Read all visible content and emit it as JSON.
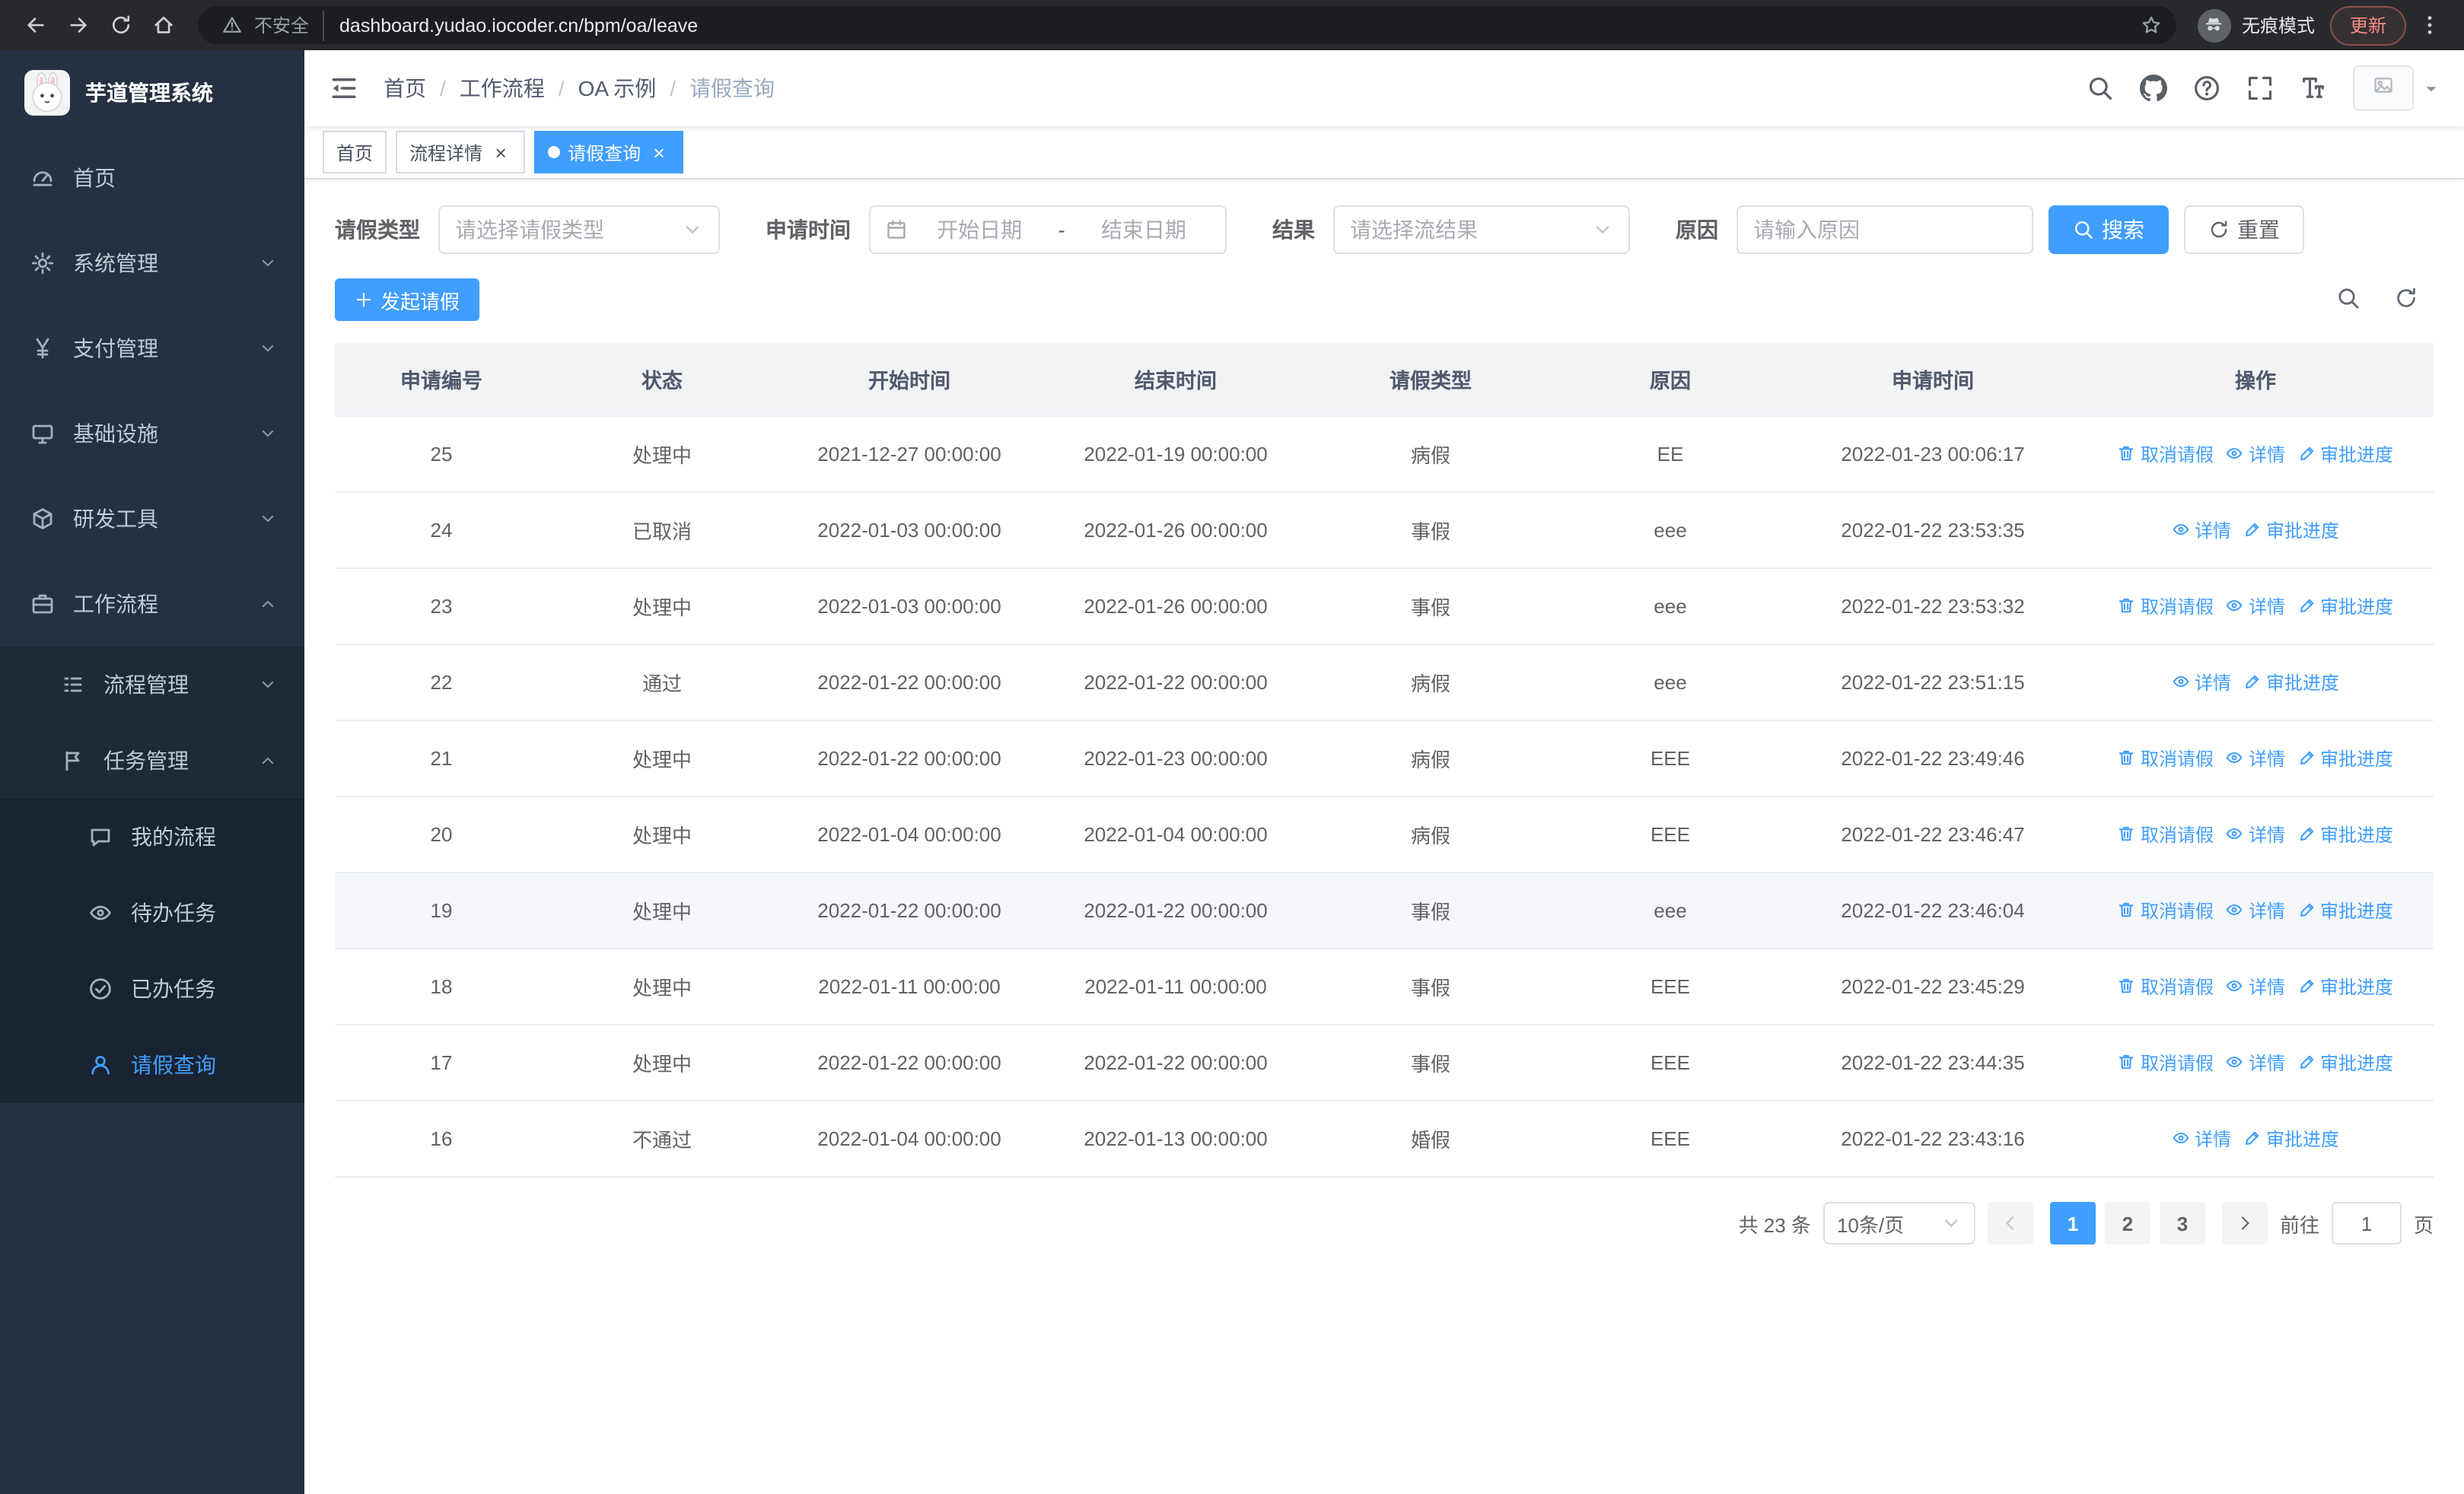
{
  "browser": {
    "security_label": "不安全",
    "url": "dashboard.yudao.iocoder.cn/bpm/oa/leave",
    "incognito_label": "无痕模式",
    "update_label": "更新"
  },
  "sidebar": {
    "app_title": "芋道管理系统",
    "items": [
      {
        "key": "home",
        "label": "首页",
        "icon": "dashboard",
        "level": 0,
        "arrow": null,
        "active": false
      },
      {
        "key": "system-management",
        "label": "系统管理",
        "icon": "gear",
        "level": 0,
        "arrow": "down",
        "active": false
      },
      {
        "key": "payment-management",
        "label": "支付管理",
        "icon": "yen",
        "level": 0,
        "arrow": "down",
        "active": false
      },
      {
        "key": "infrastructure",
        "label": "基础设施",
        "icon": "monitor",
        "level": 0,
        "arrow": "down",
        "active": false
      },
      {
        "key": "dev-tools",
        "label": "研发工具",
        "icon": "cube",
        "level": 0,
        "arrow": "down",
        "active": false
      },
      {
        "key": "workflow",
        "label": "工作流程",
        "icon": "briefcase",
        "level": 0,
        "arrow": "up",
        "active": false
      },
      {
        "key": "process-management",
        "label": "流程管理",
        "icon": "list",
        "level": 1,
        "arrow": "down",
        "active": false
      },
      {
        "key": "task-management",
        "label": "任务管理",
        "icon": "flag",
        "level": 1,
        "arrow": "up",
        "active": false
      },
      {
        "key": "my-process",
        "label": "我的流程",
        "icon": "chat",
        "level": 2,
        "arrow": null,
        "active": false
      },
      {
        "key": "todo-task",
        "label": "待办任务",
        "icon": "eye",
        "level": 2,
        "arrow": null,
        "active": false
      },
      {
        "key": "done-task",
        "label": "已办任务",
        "icon": "check-circle",
        "level": 2,
        "arrow": null,
        "active": false
      },
      {
        "key": "leave-query",
        "label": "请假查询",
        "icon": "user",
        "level": 2,
        "arrow": null,
        "active": true
      }
    ]
  },
  "header": {
    "breadcrumb": [
      "首页",
      "工作流程",
      "OA 示例",
      "请假查询"
    ]
  },
  "tabs": [
    {
      "key": "home",
      "label": "首页",
      "closable": false,
      "active": false
    },
    {
      "key": "process-detail",
      "label": "流程详情",
      "closable": true,
      "active": false
    },
    {
      "key": "leave-query",
      "label": "请假查询",
      "closable": true,
      "active": true
    }
  ],
  "filters": {
    "leave_type": {
      "label": "请假类型",
      "placeholder": "请选择请假类型"
    },
    "apply_time": {
      "label": "申请时间",
      "start_placeholder": "开始日期",
      "separator": "-",
      "end_placeholder": "结束日期"
    },
    "result": {
      "label": "结果",
      "placeholder": "请选择流结果"
    },
    "reason": {
      "label": "原因",
      "placeholder": "请输入原因"
    },
    "search_label": "搜索",
    "reset_label": "重置"
  },
  "toolbar": {
    "create_label": "发起请假"
  },
  "table": {
    "columns": [
      "申请编号",
      "状态",
      "开始时间",
      "结束时间",
      "请假类型",
      "原因",
      "申请时间",
      "操作"
    ],
    "action_defs": {
      "cancel": {
        "label": "取消请假",
        "icon": "delete"
      },
      "detail": {
        "label": "详情",
        "icon": "eye"
      },
      "progress": {
        "label": "审批进度",
        "icon": "edit"
      }
    },
    "rows": [
      {
        "id": "25",
        "status": "处理中",
        "start": "2021-12-27 00:00:00",
        "end": "2022-01-19 00:00:00",
        "type": "病假",
        "reason": "EE",
        "apply_time": "2022-01-23 00:06:17",
        "actions": [
          "cancel",
          "detail",
          "progress"
        ],
        "highlight": false
      },
      {
        "id": "24",
        "status": "已取消",
        "start": "2022-01-03 00:00:00",
        "end": "2022-01-26 00:00:00",
        "type": "事假",
        "reason": "eee",
        "apply_time": "2022-01-22 23:53:35",
        "actions": [
          "detail",
          "progress"
        ],
        "highlight": false
      },
      {
        "id": "23",
        "status": "处理中",
        "start": "2022-01-03 00:00:00",
        "end": "2022-01-26 00:00:00",
        "type": "事假",
        "reason": "eee",
        "apply_time": "2022-01-22 23:53:32",
        "actions": [
          "cancel",
          "detail",
          "progress"
        ],
        "highlight": false
      },
      {
        "id": "22",
        "status": "通过",
        "start": "2022-01-22 00:00:00",
        "end": "2022-01-22 00:00:00",
        "type": "病假",
        "reason": "eee",
        "apply_time": "2022-01-22 23:51:15",
        "actions": [
          "detail",
          "progress"
        ],
        "highlight": false
      },
      {
        "id": "21",
        "status": "处理中",
        "start": "2022-01-22 00:00:00",
        "end": "2022-01-23 00:00:00",
        "type": "病假",
        "reason": "EEE",
        "apply_time": "2022-01-22 23:49:46",
        "actions": [
          "cancel",
          "detail",
          "progress"
        ],
        "highlight": false
      },
      {
        "id": "20",
        "status": "处理中",
        "start": "2022-01-04 00:00:00",
        "end": "2022-01-04 00:00:00",
        "type": "病假",
        "reason": "EEE",
        "apply_time": "2022-01-22 23:46:47",
        "actions": [
          "cancel",
          "detail",
          "progress"
        ],
        "highlight": false
      },
      {
        "id": "19",
        "status": "处理中",
        "start": "2022-01-22 00:00:00",
        "end": "2022-01-22 00:00:00",
        "type": "事假",
        "reason": "eee",
        "apply_time": "2022-01-22 23:46:04",
        "actions": [
          "cancel",
          "detail",
          "progress"
        ],
        "highlight": true
      },
      {
        "id": "18",
        "status": "处理中",
        "start": "2022-01-11 00:00:00",
        "end": "2022-01-11 00:00:00",
        "type": "事假",
        "reason": "EEE",
        "apply_time": "2022-01-22 23:45:29",
        "actions": [
          "cancel",
          "detail",
          "progress"
        ],
        "highlight": false
      },
      {
        "id": "17",
        "status": "处理中",
        "start": "2022-01-22 00:00:00",
        "end": "2022-01-22 00:00:00",
        "type": "事假",
        "reason": "EEE",
        "apply_time": "2022-01-22 23:44:35",
        "actions": [
          "cancel",
          "detail",
          "progress"
        ],
        "highlight": false
      },
      {
        "id": "16",
        "status": "不通过",
        "start": "2022-01-04 00:00:00",
        "end": "2022-01-13 00:00:00",
        "type": "婚假",
        "reason": "EEE",
        "apply_time": "2022-01-22 23:43:16",
        "actions": [
          "detail",
          "progress"
        ],
        "highlight": false
      }
    ]
  },
  "pagination": {
    "total_label": "共 23 条",
    "page_size": "10条/页",
    "pages": [
      "1",
      "2",
      "3"
    ],
    "active_page": "1",
    "goto_label": "前往",
    "goto_value": "1",
    "goto_suffix": "页"
  },
  "colors": {
    "accent": "#409eff",
    "sidebar_bg": "#253142",
    "sidebar_submenu_bg": "#1f2a39",
    "sidebar_active_text": "#409eff",
    "table_header_bg": "#f2f3f5",
    "update_badge_text": "#f28b82"
  }
}
